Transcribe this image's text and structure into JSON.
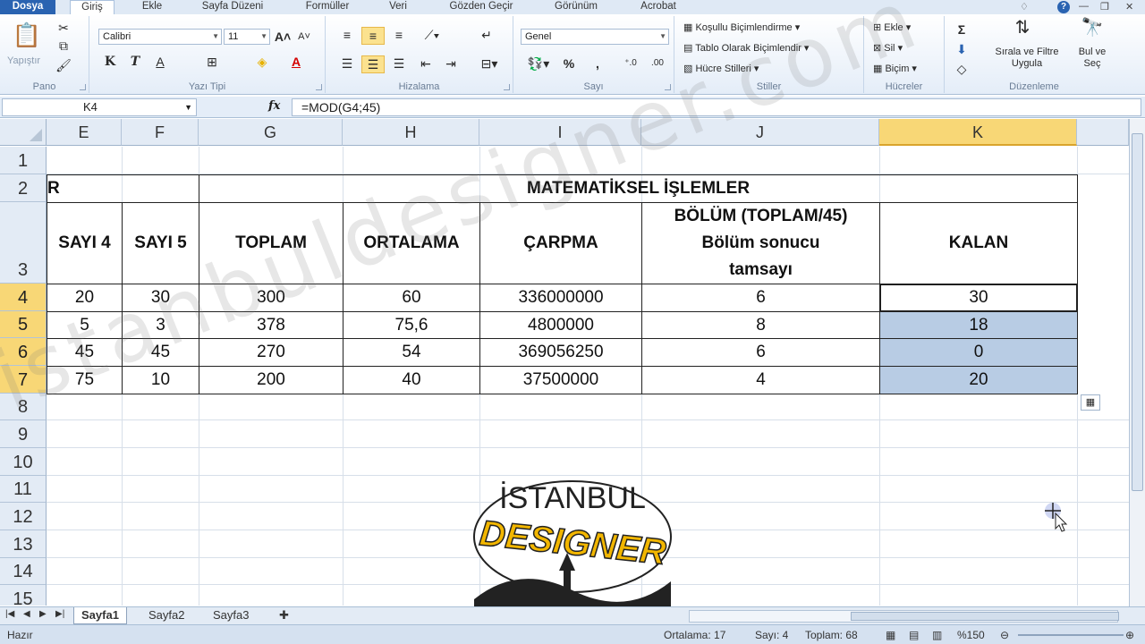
{
  "ribbon_tabs": [
    "Dosya",
    "Giriş",
    "Ekle",
    "Sayfa Düzeni",
    "Formüller",
    "Veri",
    "Gözden Geçir",
    "Görünüm",
    "Acrobat"
  ],
  "ribbon": {
    "clipboard": {
      "paste": "Yapıştır",
      "label": "Pano"
    },
    "font": {
      "name": "Calibri",
      "size": "11",
      "label": "Yazı Tipi",
      "bold": "K",
      "italic": "T",
      "underline": "A"
    },
    "alignment": {
      "label": "Hizalama"
    },
    "number": {
      "format": "Genel",
      "label": "Sayı",
      "percent": "%",
      "comma": ","
    },
    "styles": {
      "conditional": "Koşullu Biçimlendirme",
      "as_table": "Tablo Olarak Biçimlendir",
      "cell_styles": "Hücre Stilleri",
      "label": "Stiller"
    },
    "cells": {
      "insert": "Ekle",
      "delete": "Sil",
      "format": "Biçim",
      "label": "Hücreler"
    },
    "editing": {
      "sort_filter": "Sırala ve Filtre Uygula",
      "find_select": "Bul ve Seç",
      "label": "Düzenleme",
      "sum": "Σ"
    }
  },
  "formula_bar": {
    "name_box": "K4",
    "fx": "fx",
    "formula": "=MOD(G4;45)"
  },
  "columns": [
    "E",
    "F",
    "G",
    "H",
    "I",
    "J",
    "K"
  ],
  "rows": [
    "1",
    "2",
    "3",
    "4",
    "5",
    "6",
    "7",
    "8",
    "9",
    "10",
    "11",
    "12",
    "13",
    "14",
    "15"
  ],
  "sheet": {
    "row2_left_fragment": "R",
    "title": "MATEMATİKSEL İŞLEMLER",
    "headers": {
      "sayi4": "SAYI 4",
      "sayi5": "SAYI 5",
      "toplam": "TOPLAM",
      "ortalama": "ORTALAMA",
      "carpma": "ÇARPMA",
      "bolum_line1": "BÖLÜM (TOPLAM/45)",
      "bolum_line2": "Bölüm sonucu",
      "bolum_line3": "tamsayı",
      "kalan": "KALAN"
    },
    "data": [
      [
        "20",
        "30",
        "300",
        "60",
        "336000000",
        "6",
        "30"
      ],
      [
        "5",
        "3",
        "378",
        "75,6",
        "4800000",
        "8",
        "18"
      ],
      [
        "45",
        "45",
        "270",
        "54",
        "369056250",
        "6",
        "0"
      ],
      [
        "75",
        "10",
        "200",
        "40",
        "37500000",
        "4",
        "20"
      ]
    ]
  },
  "sheet_tabs": [
    "Sayfa1",
    "Sayfa2",
    "Sayfa3"
  ],
  "status": {
    "ready": "Hazır",
    "average": "Ortalama: 17",
    "count": "Sayı: 4",
    "sum": "Toplam: 68",
    "zoom": "%150"
  },
  "watermark": "istanbuldesigner.com",
  "logo_text": {
    "top": "İSTANBUL",
    "main": "DESIGNER"
  },
  "colors": {
    "file_tab": "#2a63b1",
    "selected_header": "#f8d776",
    "selection_fill": "#b8cce4",
    "ribbon_bg": "#e4edf8"
  }
}
